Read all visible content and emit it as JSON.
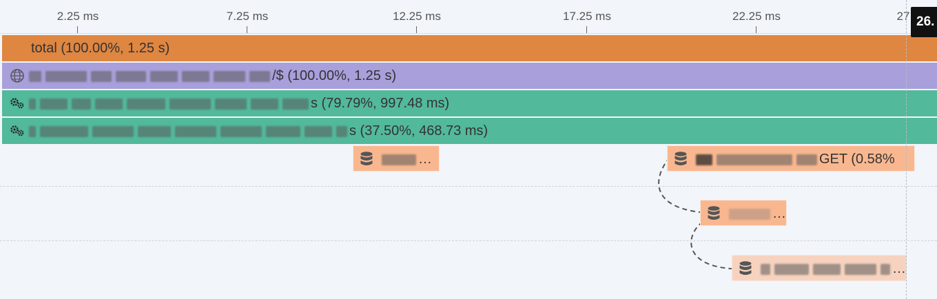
{
  "axis": {
    "ticks": [
      "2.25 ms",
      "7.25 ms",
      "12.25 ms",
      "17.25 ms",
      "22.25 ms",
      "27"
    ]
  },
  "cursor": {
    "value": "26."
  },
  "bars": {
    "total": {
      "label": "total (100.00%, 1.25 s)",
      "color": "#df8641"
    },
    "endpoint": {
      "label": "/$ (100.00%, 1.25 s)",
      "color": "#a99fdb",
      "icon": "globe-icon"
    },
    "service_1": {
      "label": "s (79.79%, 997.48 ms)",
      "color": "#52b99a",
      "icon": "gears-icon"
    },
    "service_2": {
      "label": "s (37.50%, 468.73 ms)",
      "color": "#52b99a",
      "icon": "gears-icon"
    }
  },
  "spans": {
    "span_a": {
      "label": "…",
      "icon": "database-icon",
      "color": "#f9b790"
    },
    "span_b": {
      "label": "GET (0.58%",
      "icon": "database-icon",
      "color": "#f9b790"
    },
    "span_c": {
      "label": "…",
      "icon": "database-icon",
      "color": "#f9b790"
    },
    "span_d": {
      "label": "…",
      "icon": "database-icon",
      "color": "#f7d3bf"
    }
  }
}
